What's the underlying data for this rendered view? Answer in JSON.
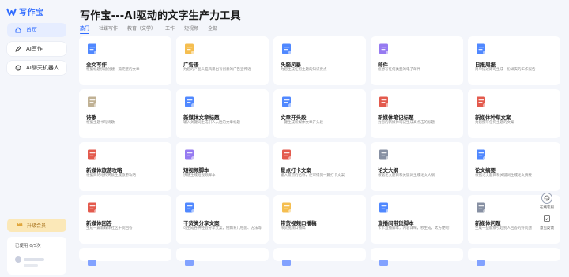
{
  "app": {
    "logo_text": "写作宝"
  },
  "sidebar": {
    "items": [
      {
        "label": "首页",
        "icon": "home-icon"
      },
      {
        "label": "AI写作",
        "icon": "pen-icon"
      },
      {
        "label": "AI聊天机器人",
        "icon": "chat-icon"
      }
    ],
    "upgrade_label": "升级会员",
    "usage_text": "已使用 0/5次"
  },
  "header": {
    "title": "写作宝---AI驱动的文字生产力工具",
    "tabs": [
      "热门",
      "社媒写作",
      "教育（文学）",
      "工作",
      "短视频",
      "全部"
    ]
  },
  "cards": [
    {
      "title": "全文写作",
      "desc": "根据标题快速创建一篇完整的文章",
      "icon": "document-blue-icon",
      "color": "#3d7bff"
    },
    {
      "title": "广告语",
      "desc": "为您的产品头脑风暴出有创意的广告宣传语",
      "icon": "folder-yellow-icon",
      "color": "#f4b73d"
    },
    {
      "title": "头脑风暴",
      "desc": "为您生成任何主题的知识要点",
      "icon": "grid-blue-icon",
      "color": "#3d7bff"
    },
    {
      "title": "邮件",
      "desc": "您想写任何类型的电子邮件",
      "icon": "mail-purple-icon",
      "color": "#8b6cf0"
    },
    {
      "title": "日报周报",
      "desc": "简单描述即可生成一份详实的工作报告",
      "icon": "report-blue-icon",
      "color": "#3d7bff"
    },
    {
      "title": "诗歌",
      "desc": "根据主题书写诗歌",
      "icon": "scroll-icon",
      "color": "#b9a888"
    },
    {
      "title": "新媒体文章标题",
      "desc": "输入关键词生成引人入胜的文章标题",
      "icon": "document-blue-icon",
      "color": "#3d7bff"
    },
    {
      "title": "文章开头段",
      "desc": "一键生成新媒体文章开头段",
      "icon": "book-blue-icon",
      "color": "#3d7bff"
    },
    {
      "title": "新媒体笔记标题",
      "desc": "为您的新媒体笔记生成高点击的标题",
      "icon": "book-red-icon",
      "color": "#e0483a"
    },
    {
      "title": "新媒体种草文案",
      "desc": "为您撰写任何主题的文案",
      "icon": "book-red-icon",
      "color": "#e0483a"
    },
    {
      "title": "新媒体旅游攻略",
      "desc": "根据目的地和天数生成旅游攻略",
      "icon": "book-red-icon",
      "color": "#e0483a"
    },
    {
      "title": "短视频脚本",
      "desc": "快速生成短视频脚本",
      "icon": "play-purple-icon",
      "color": "#8b6cf0"
    },
    {
      "title": "景点打卡文案",
      "desc": "输入景点的名称，便可得到一篇打卡文案",
      "icon": "book-red-icon",
      "color": "#e0483a"
    },
    {
      "title": "论文大纲",
      "desc": "根据论文题目和关键词生成论文大纲",
      "icon": "paper-gray-icon",
      "color": "#7a8499"
    },
    {
      "title": "论文摘要",
      "desc": "根据论文题目和关键词生成论文摘要",
      "icon": "document-blue-icon",
      "color": "#3d7bff"
    },
    {
      "title": "新媒体回答",
      "desc": "生成一篇新媒体社区干货回答",
      "icon": "hashtag-red-icon",
      "color": "#e0483a"
    },
    {
      "title": "干货类分享文案",
      "desc": "可生成各种经验分享文案，例如育儿经验、方法等",
      "icon": "share-blue-icon",
      "color": "#3d7bff"
    },
    {
      "title": "带货视频口播稿",
      "desc": "带货视频口播稿",
      "icon": "bag-yellow-icon",
      "color": "#f4b73d"
    },
    {
      "title": "直播间带货脚本",
      "desc": "卡卡直播脚本，内容详细，秒生成，太方便啦！",
      "icon": "live-blue-icon",
      "color": "#3d7bff"
    },
    {
      "title": "新媒体问题",
      "desc": "生成一些能够引起别人回答的好问题",
      "icon": "question-gray-icon",
      "color": "#7a8499"
    }
  ],
  "float_buttons": [
    {
      "label": "在线客服",
      "icon": "support-icon"
    },
    {
      "label": "意见反馈",
      "icon": "feedback-icon"
    }
  ]
}
